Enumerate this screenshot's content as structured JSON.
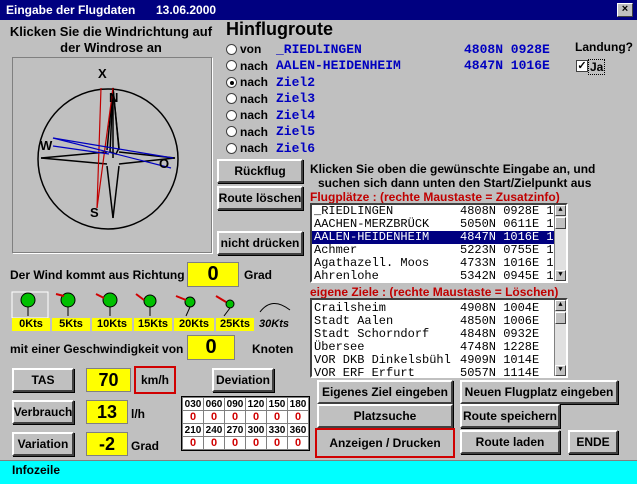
{
  "window": {
    "title": "Eingabe der Flugdaten",
    "date": "13.06.2000",
    "close_glyph": "×"
  },
  "windrose": {
    "instruction": "Klicken Sie die Windrichtung auf der Windrose an",
    "labels": {
      "x": "X",
      "n": "N",
      "w": "W",
      "o": "O",
      "s": "S"
    }
  },
  "route": {
    "heading": "Hinflugroute",
    "rows": [
      {
        "kind": "von",
        "name": "_RIEDLINGEN",
        "coord": "4808N 0928E",
        "checked": false
      },
      {
        "kind": "nach",
        "name": "AALEN-HEIDENHEIM",
        "coord": "4847N 1016E",
        "checked": false
      },
      {
        "kind": "nach",
        "name": "Ziel2",
        "coord": "",
        "checked": true
      },
      {
        "kind": "nach",
        "name": "Ziel3",
        "coord": "",
        "checked": false
      },
      {
        "kind": "nach",
        "name": "Ziel4",
        "coord": "",
        "checked": false
      },
      {
        "kind": "nach",
        "name": "Ziel5",
        "coord": "",
        "checked": false
      },
      {
        "kind": "nach",
        "name": "Ziel6",
        "coord": "",
        "checked": false
      }
    ]
  },
  "landing": {
    "label": "Landung?",
    "checkbox_label": "Ja",
    "check_glyph": "✓"
  },
  "buttons": {
    "rueckflug": "Rückflug",
    "route_loeschen": "Route löschen",
    "nicht_druecken": "nicht drücken",
    "tas": "TAS",
    "verbrauch": "Verbrauch",
    "variation": "Variation",
    "kmh": "km/h",
    "deviation": "Deviation",
    "eigenes_ziel": "Eigenes Ziel eingeben",
    "neuer_flugplatz": "Neuen Flugplatz eingeben",
    "platzsuche": "Platzsuche",
    "route_speichern": "Route speichern",
    "anzeigen_drucken": "Anzeigen / Drucken",
    "route_laden": "Route laden",
    "ende": "ENDE"
  },
  "instructions": {
    "line1": "Klicken Sie oben die gewünschte Eingabe an, und",
    "line2": "suchen sich dann unten den Start/Zielpunkt aus"
  },
  "flugplaetze": {
    "label": "Flugplätze : (rechte Maustaste = Zusatzinfo)",
    "items": [
      {
        "name": "_RIEDLINGEN",
        "coord": "4808N 0928E 1"
      },
      {
        "name": "AACHEN-MERZBRÜCK",
        "coord": "5050N 0611E 1"
      },
      {
        "name": "AALEN-HEIDENHEIM",
        "coord": "4847N 1016E 1",
        "selected": true
      },
      {
        "name": "Achmer",
        "coord": "5223N 0755E 1"
      },
      {
        "name": "Agathazell. Moos",
        "coord": "4733N 1016E 1"
      },
      {
        "name": "Ahrenlohe",
        "coord": "5342N 0945E 1"
      }
    ]
  },
  "eigene_ziele": {
    "label": "eigene Ziele :  (rechte Maustaste = Löschen)",
    "items": [
      {
        "name": "Crailsheim",
        "coord": "4908N 1004E"
      },
      {
        "name": "Stadt Aalen",
        "coord": "4850N 1006E"
      },
      {
        "name": "Stadt Schorndorf",
        "coord": "4848N 0932E"
      },
      {
        "name": "Übersee",
        "coord": "4748N 1228E"
      },
      {
        "name": "VOR DKB Dinkelsbühl",
        "coord": "4909N 1014E"
      },
      {
        "name": "VOR ERF Erfurt",
        "coord": "5057N 1114E"
      }
    ]
  },
  "wind": {
    "direction_label": "Der Wind kommt aus Richtung",
    "direction_value": "0",
    "direction_unit": "Grad",
    "speed_label": "mit einer Geschwindigkeit von",
    "speed_value": "0",
    "speed_unit": "Knoten",
    "scale": [
      "0Kts",
      "5Kts",
      "10Kts",
      "15Kts",
      "20Kts",
      "25Kts",
      "30Kts"
    ]
  },
  "values": {
    "tas": "70",
    "verbrauch": "13",
    "verbrauch_unit": "l/h",
    "variation": "-2",
    "variation_unit": "Grad"
  },
  "deviation": {
    "row1_headers": [
      "030",
      "060",
      "090",
      "120",
      "150",
      "180"
    ],
    "row1_values": [
      "0",
      "0",
      "0",
      "0",
      "0",
      "0"
    ],
    "row2_headers": [
      "210",
      "240",
      "270",
      "300",
      "330",
      "360"
    ],
    "row2_values": [
      "0",
      "0",
      "0",
      "0",
      "0",
      "0"
    ]
  },
  "infobar": {
    "text": "Infozeile"
  }
}
